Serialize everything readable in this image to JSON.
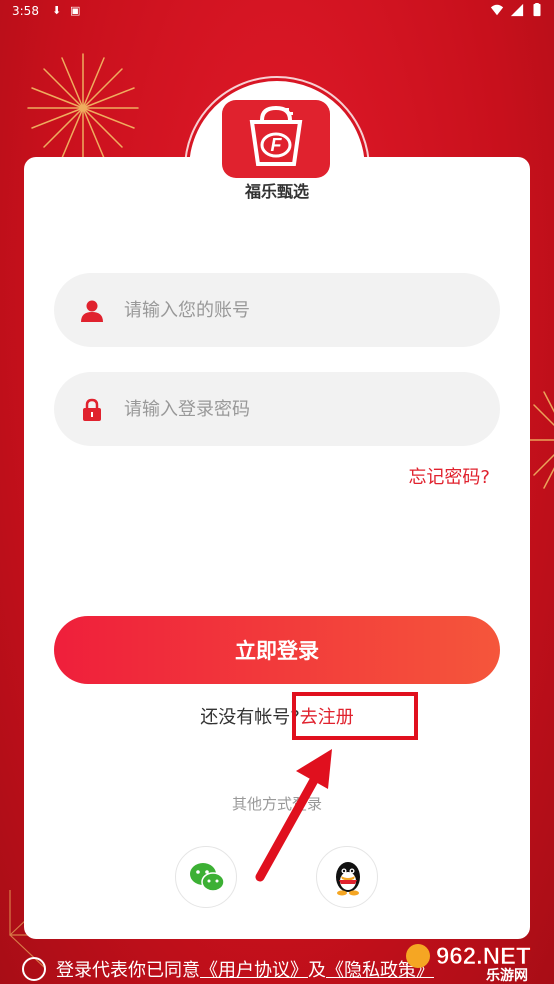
{
  "status_bar": {
    "time": "3:58",
    "icons": [
      "download-icon",
      "notification-icon",
      "wifi-icon",
      "signal-icon",
      "battery-icon"
    ]
  },
  "logo": {
    "app_name": "福乐甄选",
    "mark": "F"
  },
  "login_form": {
    "account_placeholder": "请输入您的账号",
    "password_placeholder": "请输入登录密码",
    "forgot_password": "忘记密码?",
    "login_button": "立即登录",
    "register_prompt": "还没有帐号?",
    "register_link": "去注册",
    "other_methods": "其他方式登录"
  },
  "social": [
    "wechat-icon",
    "qq-icon"
  ],
  "agreement": {
    "prefix": "登录代表你已同意",
    "user_agreement": "《用户协议》",
    "and": "及",
    "privacy": "《隐私政策》"
  },
  "watermark": {
    "brand": "962.NET",
    "sub": "乐游网"
  },
  "colors": {
    "brand_red": "#e0222e",
    "background": "#c8101c",
    "button_gradient_start": "#ef1f3b",
    "button_gradient_end": "#f5563b"
  }
}
